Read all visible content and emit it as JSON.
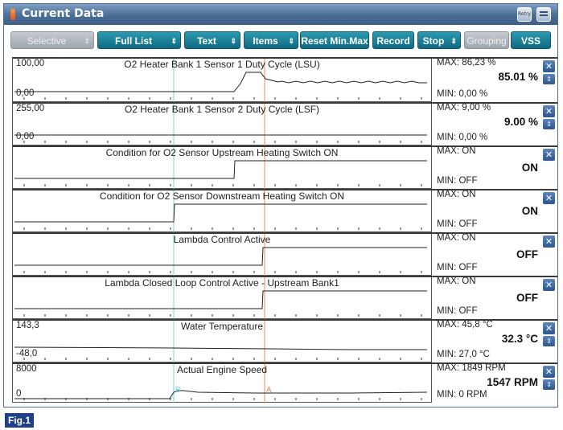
{
  "window": {
    "title": "Current Data",
    "retry_label": "Retry"
  },
  "toolbar": [
    {
      "id": "selective-display",
      "label": "Selective Display",
      "caret": "⇕",
      "enabled": false
    },
    {
      "id": "full-list",
      "label": "Full List",
      "caret": "⇕",
      "enabled": true
    },
    {
      "id": "text",
      "label": "Text",
      "caret": "⇕",
      "enabled": true
    },
    {
      "id": "items-list",
      "label": "Items List",
      "caret": "⇕",
      "enabled": true
    },
    {
      "id": "reset-min-max",
      "label": "Reset Min.Max",
      "caret": "",
      "enabled": true
    },
    {
      "id": "record",
      "label": "Record",
      "caret": "",
      "enabled": true
    },
    {
      "id": "stop",
      "label": "Stop",
      "caret": "⇕",
      "enabled": true
    },
    {
      "id": "grouping",
      "label": "Grouping",
      "caret": "",
      "enabled": false
    },
    {
      "id": "vss",
      "label": "VSS",
      "caret": "",
      "enabled": true
    }
  ],
  "colors": {
    "cursor_cyan": "#6fd3dd",
    "cursor_a": "#ef8a5a",
    "toolbar_teal": "#1a7f98",
    "title_blue": "#4a6d96"
  },
  "markers": {
    "b_label": "B",
    "a_label": "A"
  },
  "rows": [
    {
      "title": "O2 Heater Bank 1 Sensor 1 Duty Cycle (LSU)",
      "scale_max": "100,00",
      "scale_min": "0,00",
      "max": "MAX:  86,23 %",
      "min": "MIN:  0,00 %",
      "value": "85.01 %",
      "has_scroll": true,
      "kind": "analog"
    },
    {
      "title": "O2 Heater Bank 1 Sensor 2 Duty Cycle (LSF)",
      "scale_max": "255,00",
      "scale_min": "0,00",
      "max": "MAX:  9,00 %",
      "min": "MIN:  0,00 %",
      "value": "9.00 %",
      "has_scroll": true,
      "kind": "analog"
    },
    {
      "title": "Condition for O2 Sensor Upstream Heating Switch ON",
      "scale_max": "",
      "scale_min": "",
      "max": "MAX: ON",
      "min": "MIN: OFF",
      "value": "ON",
      "has_scroll": false,
      "kind": "digital"
    },
    {
      "title": "Condition for O2 Sensor Downstream Heating Switch ON",
      "scale_max": "",
      "scale_min": "",
      "max": "MAX: ON",
      "min": "MIN: OFF",
      "value": "ON",
      "has_scroll": false,
      "kind": "digital"
    },
    {
      "title": "Lambda Control Active",
      "scale_max": "",
      "scale_min": "",
      "max": "MAX: ON",
      "min": "MIN: OFF",
      "value": "OFF",
      "has_scroll": false,
      "kind": "digital"
    },
    {
      "title": "Lambda Closed Loop Control Active - Upstream Bank1",
      "scale_max": "",
      "scale_min": "",
      "max": "MAX: ON",
      "min": "MIN: OFF",
      "value": "OFF",
      "has_scroll": false,
      "kind": "digital"
    },
    {
      "title": "Water Temperature",
      "scale_max": "143,3",
      "scale_min": "-48,0",
      "max": "MAX:  45,8 °C",
      "min": "MIN:  27,0 °C",
      "value": "32.3 °C",
      "has_scroll": true,
      "kind": "analog"
    },
    {
      "title": "Actual Engine Speed",
      "scale_max": "8000",
      "scale_min": "0",
      "max": "MAX:    1849 RPM",
      "min": "MIN:     0 RPM",
      "value": "1547 RPM",
      "has_scroll": true,
      "kind": "analog"
    }
  ],
  "figure_label": "Fig.1"
}
